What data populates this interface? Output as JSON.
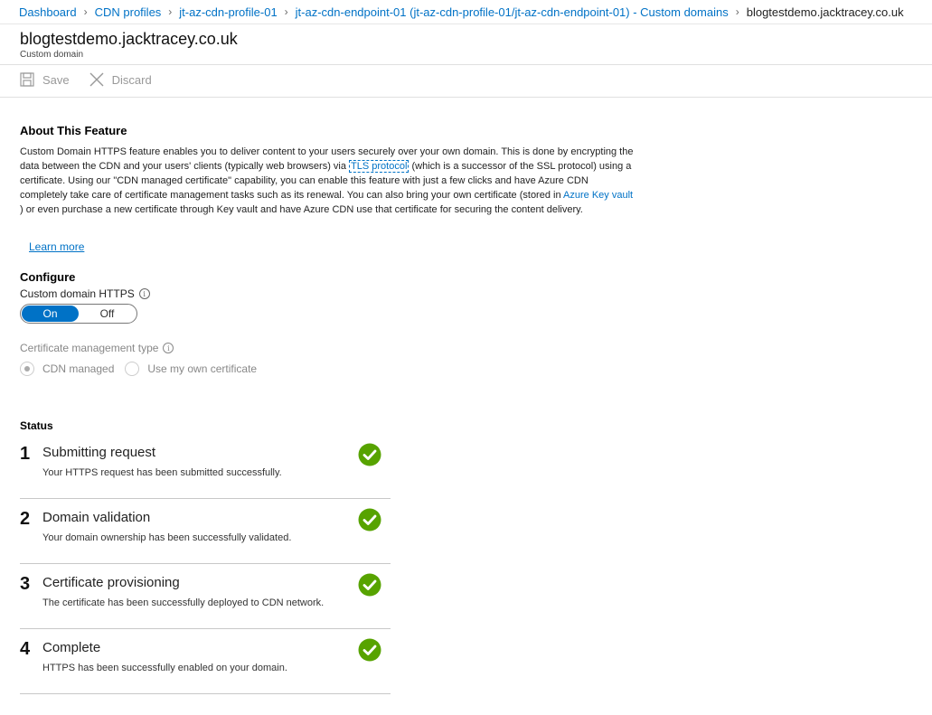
{
  "breadcrumb": {
    "items": [
      "Dashboard",
      "CDN profiles",
      "jt-az-cdn-profile-01",
      "jt-az-cdn-endpoint-01 (jt-az-cdn-profile-01/jt-az-cdn-endpoint-01) - Custom domains"
    ],
    "current": "blogtestdemo.jacktracey.co.uk"
  },
  "header": {
    "title": "blogtestdemo.jacktracey.co.uk",
    "subtitle": "Custom domain"
  },
  "toolbar": {
    "save_label": "Save",
    "discard_label": "Discard"
  },
  "about": {
    "heading": "About This Feature",
    "text_1": "Custom Domain HTTPS feature enables you to deliver content to your users securely over your own domain. This is done by encrypting the data between the CDN and your users' clients (typically web browsers) via ",
    "tls_link": "TLS protocol",
    "text_2": " (which is a successor of the SSL protocol) using a certificate. Using our \"CDN managed certificate\" capability, you can enable this feature with just a few clicks and have Azure CDN completely take care of certificate management tasks such as its renewal. You can also bring your own certificate (stored in ",
    "keyvault_link": "Azure Key vault",
    "text_3": " ) or even purchase a new certificate through Key vault and have Azure CDN use that certificate for securing the content delivery.",
    "learn_more": "Learn more"
  },
  "configure": {
    "heading": "Configure",
    "https_label": "Custom domain HTTPS",
    "toggle_on": "On",
    "toggle_off": "Off",
    "toggle_state": "On",
    "cert_type_label": "Certificate management type",
    "radio_options": [
      "CDN managed",
      "Use my own certificate"
    ],
    "radio_selected": "CDN managed"
  },
  "status": {
    "heading": "Status",
    "steps": [
      {
        "number": "1",
        "title": "Submitting request",
        "description": "Your HTTPS request has been submitted successfully."
      },
      {
        "number": "2",
        "title": "Domain validation",
        "description": "Your domain ownership has been successfully validated."
      },
      {
        "number": "3",
        "title": "Certificate provisioning",
        "description": "The certificate has been successfully deployed to CDN network."
      },
      {
        "number": "4",
        "title": "Complete",
        "description": "HTTPS has been successfully enabled on your domain."
      }
    ]
  },
  "colors": {
    "accent": "#0072c6",
    "success": "#57a300"
  }
}
